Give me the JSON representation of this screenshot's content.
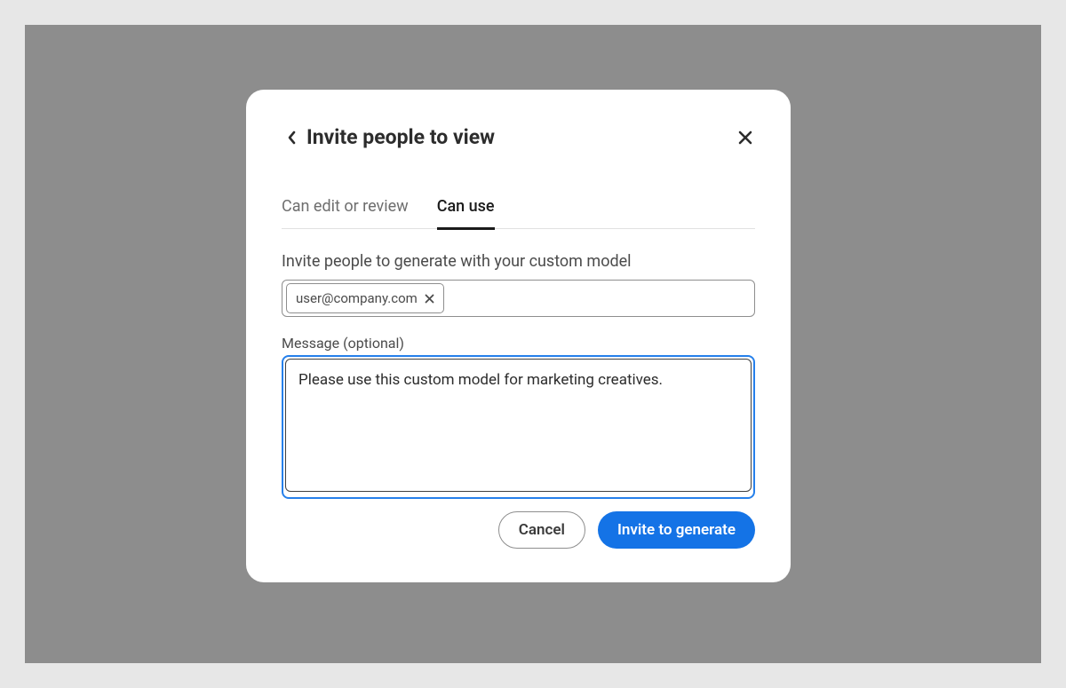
{
  "dialog": {
    "title": "Invite people to view"
  },
  "tabs": {
    "edit": "Can edit or review",
    "use": "Can use"
  },
  "invite": {
    "section_label": "Invite people to generate with your custom model",
    "chip_email": "user@company.com"
  },
  "message": {
    "label": "Message (optional)",
    "value": "Please use this custom model for marketing creatives."
  },
  "buttons": {
    "cancel": "Cancel",
    "invite": "Invite to generate"
  }
}
